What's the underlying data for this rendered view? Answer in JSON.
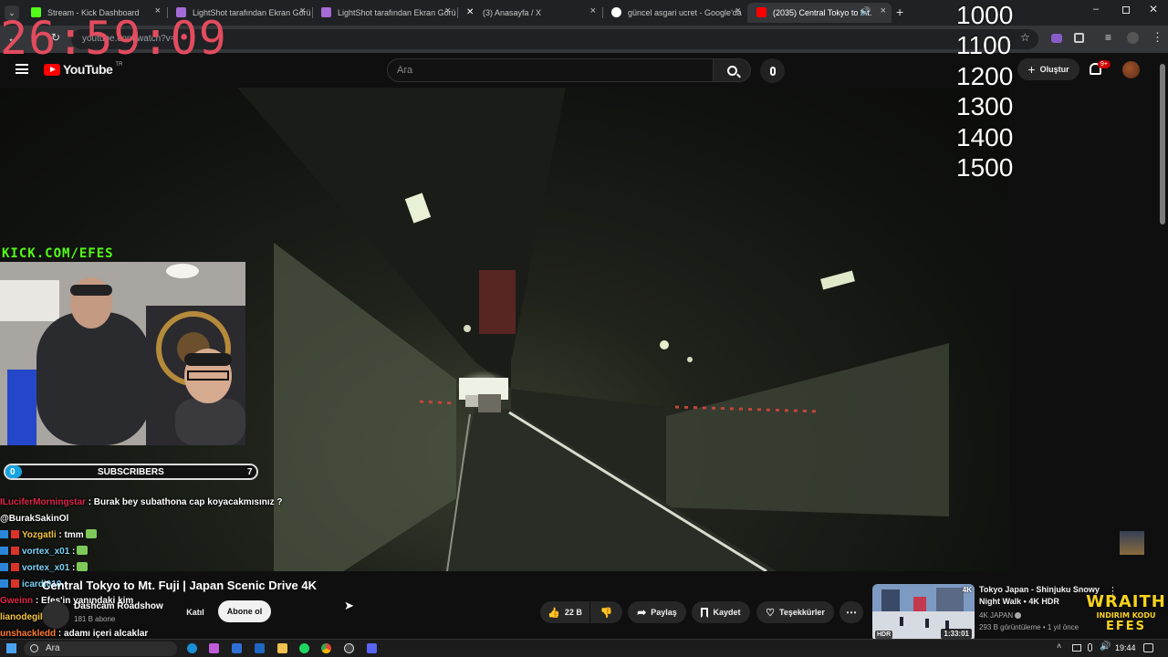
{
  "browser": {
    "tabs": [
      {
        "label": "Stream - Kick Dashboard",
        "favicon_color": "#53fc18"
      },
      {
        "label": "LightShot tarafından Ekran Görü",
        "favicon_color": "#a46bd6"
      },
      {
        "label": "LightShot tarafından Ekran Görü",
        "favicon_color": "#a46bd6"
      },
      {
        "label": "(3) Anasayfa / X",
        "favicon_color": "#ffffff"
      },
      {
        "label": "güncel asgari ucret - Google'da",
        "favicon_color": "#4285f4"
      },
      {
        "label": "(2035) Central Tokyo to Mt.",
        "favicon_color": "#ff0000"
      }
    ],
    "new_tab_label": "+",
    "url": "youtube.com/watch?v="
  },
  "youtube": {
    "logo_text": "YouTube",
    "region": "TR",
    "search_placeholder": "Ara",
    "create_label": "Oluştur",
    "notifications_badge": "9+"
  },
  "overlay": {
    "timer": "26:59:09",
    "goals": [
      "1000",
      "1100",
      "1200",
      "1300",
      "1400",
      "1500"
    ],
    "kick_tag": "KICK.COM/EFES",
    "subs_bar": {
      "start": "0",
      "label": "SUBSCRIBERS",
      "end": "7",
      "progress": 0.0
    },
    "chat": [
      {
        "user": "ILuciferMorningstar",
        "user_color": "#e0254a",
        "text": ": Burak bey subathona cap koyacakmısınız ?",
        "badges": 0,
        "emote": false
      },
      {
        "user": "",
        "user_color": "#ffffff",
        "text": "@BurakSakinOl",
        "badges": 0,
        "emote": false
      },
      {
        "user": "Yozgatli",
        "user_color": "#f4c542",
        "text": ": tmm",
        "badges": 2,
        "emote": true
      },
      {
        "user": "vortex_x01",
        "user_color": "#7cd3f7",
        "text": ":",
        "badges": 2,
        "emote": true
      },
      {
        "user": "vortex_x01",
        "user_color": "#7cd3f7",
        "text": ":",
        "badges": 2,
        "emote": true
      },
      {
        "user": "icardi010",
        "user_color": "#7cd3f7",
        "text": ":",
        "badges": 2,
        "emote": false
      },
      {
        "user": "Gweinn",
        "user_color": "#e0254a",
        "text": ": Efes'in yanındaki kim",
        "badges": 0,
        "emote": false
      },
      {
        "user": "lianodegil",
        "user_color": "#f4c542",
        "text": ":",
        "badges": 0,
        "emote": true
      },
      {
        "user": "unshackledd",
        "user_color": "#ff7a2f",
        "text": ": adamı içeri alcaklar",
        "badges": 0,
        "emote": false
      }
    ]
  },
  "video": {
    "title": "Central Tokyo to Mt. Fuji | Japan Scenic Drive 4K",
    "channel": "Dashcam Roadshow",
    "subscribers": "181 B abone",
    "join_label": "Katıl",
    "subscribe_label": "Abone ol",
    "likes": "22 B",
    "share_label": "Paylaş",
    "save_label": "Kaydet",
    "thanks_label": "Teşekkürler"
  },
  "recommendation": {
    "title": "Tokyo Japan - Shinjuku Snowy Night Walk • 4K HDR",
    "channel": "4K JAPAN",
    "meta": "293 B görüntüleme • 1 yıl önce",
    "duration": "1:33:01",
    "quality_badge": "4K",
    "hdr_badge": "HDR"
  },
  "sponsor": {
    "brand": "WRAITH",
    "line1": "INDIRIM KODU",
    "code": "EFES"
  },
  "taskbar": {
    "search_placeholder": "Ara",
    "clock": "19:44"
  }
}
